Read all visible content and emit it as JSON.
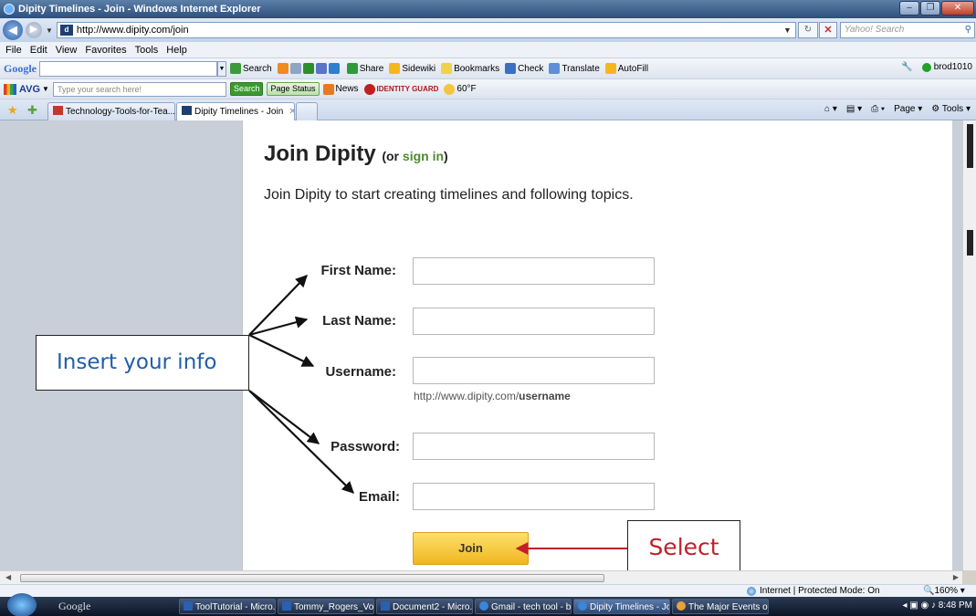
{
  "window": {
    "title": "Dipity Timelines - Join - Windows Internet Explorer"
  },
  "address": {
    "url": "http://www.dipity.com/join",
    "search_placeholder": "Yahoo! Search"
  },
  "menu": [
    "File",
    "Edit",
    "View",
    "Favorites",
    "Tools",
    "Help"
  ],
  "google_toolbar": {
    "logo": "Google",
    "items": [
      "Search",
      "Share",
      "Sidewiki",
      "Bookmarks",
      "Check",
      "Translate",
      "AutoFill"
    ],
    "user": "brod1010"
  },
  "avg_toolbar": {
    "logo": "AVG",
    "search_placeholder": "Type your search here!",
    "search_button": "Search",
    "page_status": "Page Status",
    "news": "News",
    "identity": "IDENTITY GUARD",
    "weather": "60°F"
  },
  "tabs": [
    {
      "label": "Technology-Tools-for-Tea..."
    },
    {
      "label": "Dipity Timelines - Join"
    }
  ],
  "tab_tools": {
    "page": "Page",
    "tools": "Tools"
  },
  "form": {
    "title": "Join Dipity",
    "or_prefix": "(or ",
    "sign_in": "sign in",
    "or_suffix": ")",
    "subtitle": "Join Dipity to start creating timelines and following topics.",
    "fields": {
      "first_name": "First Name:",
      "last_name": "Last Name:",
      "username": "Username:",
      "password": "Password:",
      "email": "Email:"
    },
    "url_hint_prefix": "http://www.dipity.com/",
    "url_hint_bold": "username",
    "join_button": "Join"
  },
  "annotations": {
    "insert_info": "Insert your info",
    "select": "Select"
  },
  "status": {
    "zone": "Internet | Protected Mode: On",
    "zoom": "160%"
  },
  "taskbar": {
    "search_label": "Google",
    "tasks": [
      "ToolTutorial - Micro...",
      "Tommy_Rogers_Voi...",
      "Document2 - Micro...",
      "Gmail - tech tool - b...",
      "Dipity Timelines - Jo...",
      "The Major Events of..."
    ],
    "clock": "8:48 PM"
  }
}
